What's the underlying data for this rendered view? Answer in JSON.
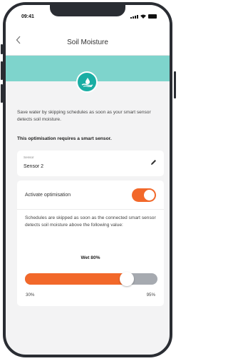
{
  "status_bar": {
    "time": "09:41",
    "icons": [
      "signal-icon",
      "wifi-icon",
      "battery-icon"
    ]
  },
  "nav": {
    "back_icon": "chevron-left-icon",
    "title": "Soil Moisture"
  },
  "banner": {
    "icon": "soil-moisture-icon"
  },
  "description": "Save water by skipping schedules as soon as your smart sensor detects soil moisture.",
  "requirement": "This optimisation requires a smart sensor.",
  "sensor": {
    "label": "Sensor",
    "value": "Sensor 2",
    "edit_icon": "pencil-icon"
  },
  "optimisation": {
    "toggle_label": "Activate optimisation",
    "enabled": true,
    "explanation": "Schedules are skipped as soon as the connected smart sensor detects soil moisture above the following value:",
    "value_label": "Wet 80%",
    "slider": {
      "min": 30,
      "max": 95,
      "value": 80,
      "min_label": "30%",
      "max_label": "95%"
    }
  },
  "colors": {
    "accent": "#f2682a",
    "banner": "#7ed4cc",
    "badge": "#1aaea4",
    "track": "#a6aab0",
    "frame": "#2a2d33"
  }
}
